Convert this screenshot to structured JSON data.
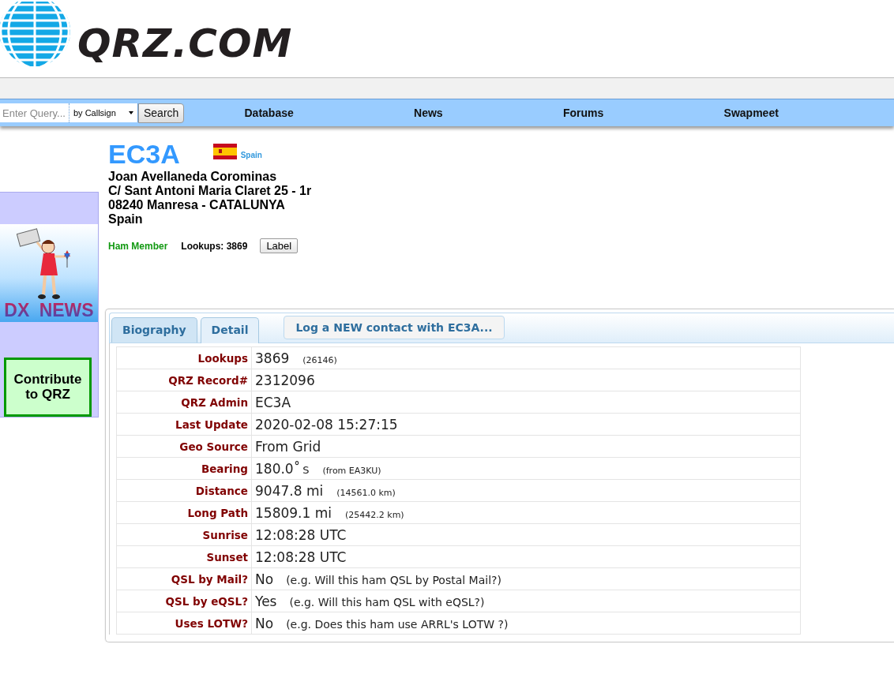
{
  "logo": {
    "text": "QRZ.COM"
  },
  "search": {
    "placeholder": "Enter Query...",
    "mode": "by Callsign",
    "button": "Search"
  },
  "nav": [
    "Database",
    "News",
    "Forums",
    "Swapmeet"
  ],
  "sidebar": {
    "ad_text": "DX NEWS",
    "contribute": "Contribute to QRZ"
  },
  "profile": {
    "callsign": "EC3A",
    "country": "Spain",
    "address": [
      "Joan Avellaneda Corominas",
      "C/ Sant Antoni Maria Claret 25 - 1r",
      "08240 Manresa - CATALUNYA",
      "Spain"
    ],
    "membership": "Ham Member",
    "lookups": "Lookups: 3869",
    "label_button": "Label"
  },
  "tabs": [
    {
      "label": "Biography",
      "selected": false
    },
    {
      "label": "Detail",
      "selected": true
    }
  ],
  "log_button": "Log a NEW contact with EC3A...",
  "details": [
    {
      "label": "Lookups",
      "value": "3869",
      "note": "(26146)"
    },
    {
      "label": "QRZ Record#",
      "value": "2312096"
    },
    {
      "label": "QRZ Admin",
      "value": "EC3A"
    },
    {
      "label": "Last Update",
      "value": "2020-02-08 15:27:15"
    },
    {
      "label": "Geo Source",
      "value": "From Grid"
    },
    {
      "label": "Bearing",
      "value": "180.0˚",
      "unit": "S",
      "note": "(from EA3KU)"
    },
    {
      "label": "Distance",
      "value": "9047.8 mi",
      "note": "(14561.0 km)"
    },
    {
      "label": "Long Path",
      "value": "15809.1 mi",
      "note": "(25442.2 km)"
    },
    {
      "label": "Sunrise",
      "value": "12:08:28 UTC"
    },
    {
      "label": "Sunset",
      "value": "12:08:28 UTC"
    },
    {
      "label": "QSL by Mail?",
      "value": "No",
      "hint": "(e.g. Will this ham QSL by Postal Mail?)"
    },
    {
      "label": "QSL by eQSL?",
      "value": "Yes",
      "hint": "(e.g. Will this ham QSL with eQSL?)"
    },
    {
      "label": "Uses LOTW?",
      "value": "No",
      "hint": "(e.g. Does this ham use ARRL's LOTW ?)"
    }
  ]
}
